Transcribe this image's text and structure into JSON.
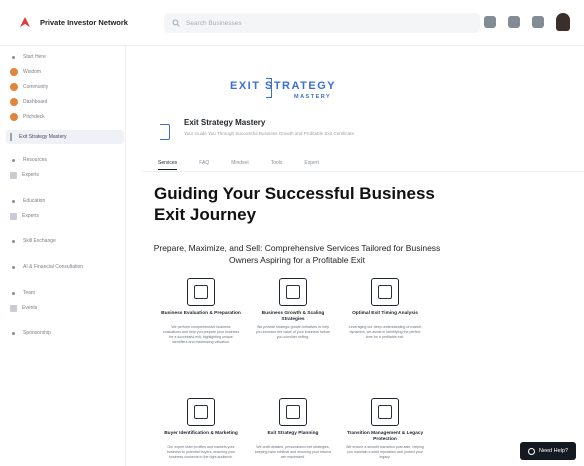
{
  "app": {
    "brand_name": "Private Investor Network"
  },
  "search": {
    "placeholder": "Search Businesses"
  },
  "sidebar": {
    "items": [
      {
        "label": "Start Here",
        "kind": "bullet"
      },
      {
        "label": "Wisdom",
        "kind": "icon"
      },
      {
        "label": "Community",
        "kind": "icon"
      },
      {
        "label": "Dashboard",
        "kind": "icon"
      },
      {
        "label": "Pitchdeck",
        "kind": "icon"
      },
      {
        "label": "Exit Strategy Mastery",
        "kind": "active"
      },
      {
        "label": "Resources",
        "kind": "bullet"
      },
      {
        "label": "Experts",
        "kind": "square"
      },
      {
        "label": "Education",
        "kind": "bullet"
      },
      {
        "label": "Experts",
        "kind": "square"
      },
      {
        "label": "Skill Exchange",
        "kind": "bullet"
      },
      {
        "label": "AI & Financial Consultation",
        "kind": "bullet"
      },
      {
        "label": "Team",
        "kind": "bullet"
      },
      {
        "label": "Events",
        "kind": "square"
      },
      {
        "label": "Sponsorship",
        "kind": "bullet"
      }
    ]
  },
  "logo": {
    "word": "EXIT STRATEGY",
    "sub": "MASTERY"
  },
  "header": {
    "title": "Exit Strategy Mastery",
    "subtitle": "Your Guide You Through Successful Business Growth and Profitable Exit Certificate"
  },
  "tabs": [
    "Services",
    "FAQ",
    "Mindset",
    "Tools",
    "Expert"
  ],
  "main": {
    "headline": "Guiding Your Successful Business Exit Journey",
    "subheadline": "Prepare, Maximize, and Sell: Comprehensive Services Tailored for Business Owners Aspiring for a Profitable Exit"
  },
  "services": [
    {
      "title": "Business Evaluation & Preparation",
      "desc": "We perform comprehensive business evaluations and help you prepare your business for a successful exit, highlighting unique identifiers and maximizing valuation."
    },
    {
      "title": "Business Growth & Scaling Strategies",
      "desc": "We provide strategic growth initiatives to help you increase the value of your business before you consider selling."
    },
    {
      "title": "Optimal Exit Timing Analysis",
      "desc": "Leveraging our deep understanding of market dynamics, we assist in identifying the perfect time for a profitable exit."
    },
    {
      "title": "Buyer Identification & Marketing",
      "desc": "Our expert team profiles and markets your business to potential buyers, ensuring your business connects to the right audience."
    },
    {
      "title": "Exit Strategy Planning",
      "desc": "We craft detailed, personalized exit strategies, keeping risks minimal and ensuring your returns are maximized."
    },
    {
      "title": "Transition Management & Legacy Protection",
      "desc": "We ensure a smooth transition post-sale, helping you maintain a solid reputation and protect your legacy."
    }
  ],
  "help": {
    "label": "Need Help?"
  },
  "colors": {
    "accent": "#3a6fd6",
    "brand_red": "#e23a3a",
    "sidebar_icon": "#e0853a"
  }
}
